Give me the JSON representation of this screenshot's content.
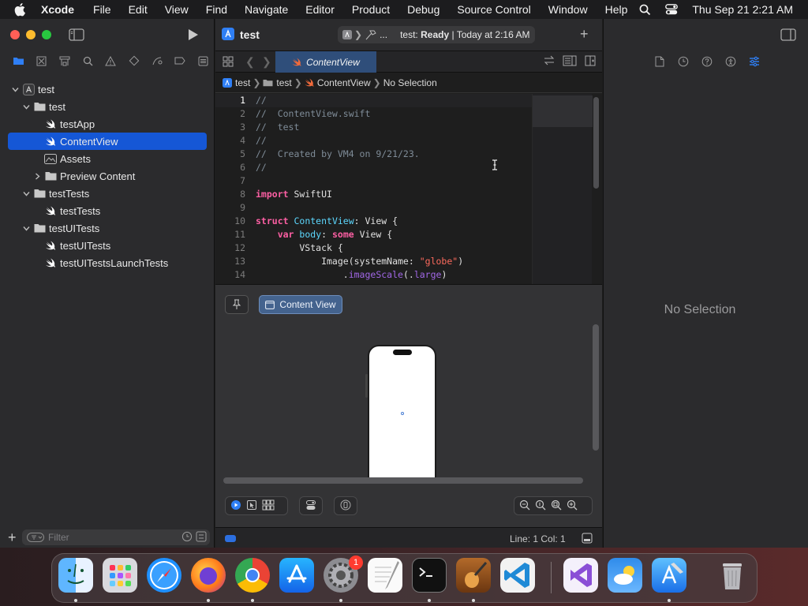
{
  "menubar": {
    "app": "Xcode",
    "items": [
      "File",
      "Edit",
      "View",
      "Find",
      "Navigate",
      "Editor",
      "Product",
      "Debug",
      "Source Control",
      "Window",
      "Help"
    ],
    "clock": "Thu Sep 21  2:21 AM"
  },
  "navigator": {
    "tree": [
      {
        "label": "test",
        "icon": "project-icon",
        "level": 0,
        "disclosure": "open"
      },
      {
        "label": "test",
        "icon": "folder-icon",
        "level": 1,
        "disclosure": "open"
      },
      {
        "label": "testApp",
        "icon": "swift-file-icon",
        "level": 2,
        "disclosure": "none"
      },
      {
        "label": "ContentView",
        "icon": "swift-file-icon",
        "level": 2,
        "disclosure": "none",
        "selected": true
      },
      {
        "label": "Assets",
        "icon": "asset-catalog-icon",
        "level": 2,
        "disclosure": "none"
      },
      {
        "label": "Preview Content",
        "icon": "folder-icon",
        "level": 2,
        "disclosure": "closed"
      },
      {
        "label": "testTests",
        "icon": "folder-icon",
        "level": 1,
        "disclosure": "open"
      },
      {
        "label": "testTests",
        "icon": "swift-file-icon",
        "level": 2,
        "disclosure": "none"
      },
      {
        "label": "testUITests",
        "icon": "folder-icon",
        "level": 1,
        "disclosure": "open"
      },
      {
        "label": "testUITests",
        "icon": "swift-file-icon",
        "level": 2,
        "disclosure": "none"
      },
      {
        "label": "testUITestsLaunchTests",
        "icon": "swift-file-icon",
        "level": 2,
        "disclosure": "none"
      }
    ],
    "filter_placeholder": "Filter"
  },
  "toolbar": {
    "project_title": "test",
    "scheme_device": "...",
    "status_project": "test:",
    "status_state": "Ready",
    "status_time": "| Today at 2:16 AM"
  },
  "editor": {
    "tab_label": "ContentView",
    "jumpbar": [
      "test",
      "test",
      "ContentView",
      "No Selection"
    ],
    "current_line": 1,
    "lines": [
      [
        {
          "t": "//",
          "c": "com"
        }
      ],
      [
        {
          "t": "//  ContentView.swift",
          "c": "com"
        }
      ],
      [
        {
          "t": "//  test",
          "c": "com"
        }
      ],
      [
        {
          "t": "//",
          "c": "com"
        }
      ],
      [
        {
          "t": "//  Created by VM4 on 9/21/23.",
          "c": "com"
        }
      ],
      [
        {
          "t": "//",
          "c": "com"
        }
      ],
      [],
      [
        {
          "t": "import",
          "c": "kw"
        },
        {
          "t": " SwiftUI",
          "c": ""
        }
      ],
      [],
      [
        {
          "t": "struct",
          "c": "kw"
        },
        {
          "t": " ",
          "c": ""
        },
        {
          "t": "ContentView",
          "c": "type"
        },
        {
          "t": ": View {",
          "c": ""
        }
      ],
      [
        {
          "t": "    ",
          "c": ""
        },
        {
          "t": "var",
          "c": "kw"
        },
        {
          "t": " ",
          "c": ""
        },
        {
          "t": "body",
          "c": "type"
        },
        {
          "t": ": ",
          "c": ""
        },
        {
          "t": "some",
          "c": "kw"
        },
        {
          "t": " View {",
          "c": ""
        }
      ],
      [
        {
          "t": "        VStack {",
          "c": ""
        }
      ],
      [
        {
          "t": "            Image(systemName: ",
          "c": ""
        },
        {
          "t": "\"globe\"",
          "c": "str"
        },
        {
          "t": ")",
          "c": ""
        }
      ],
      [
        {
          "t": "                .",
          "c": ""
        },
        {
          "t": "imageScale",
          "c": "fn"
        },
        {
          "t": "(.",
          "c": ""
        },
        {
          "t": "large",
          "c": "fn"
        },
        {
          "t": ")",
          "c": ""
        }
      ]
    ]
  },
  "canvas": {
    "content_view_button": "Content View"
  },
  "statusbar": {
    "position": "Line: 1  Col: 1"
  },
  "inspector": {
    "empty_label": "No Selection"
  },
  "dock": {
    "apps": [
      "finder-icon",
      "launchpad-icon",
      "safari-icon",
      "firefox-icon",
      "chrome-icon",
      "app-store-icon",
      "system-settings-icon",
      "textedit-icon",
      "terminal-icon",
      "garageband-icon",
      "vscode-icon",
      "visual-studio-icon",
      "weather-icon",
      "xcode-icon",
      "trash-icon"
    ],
    "settings_badge": "1"
  },
  "colors": {
    "selection": "#1557d6",
    "keyword": "#fc5fa3",
    "type": "#5dd8ff",
    "string": "#fc6a5d",
    "comment": "#7f8c98"
  }
}
